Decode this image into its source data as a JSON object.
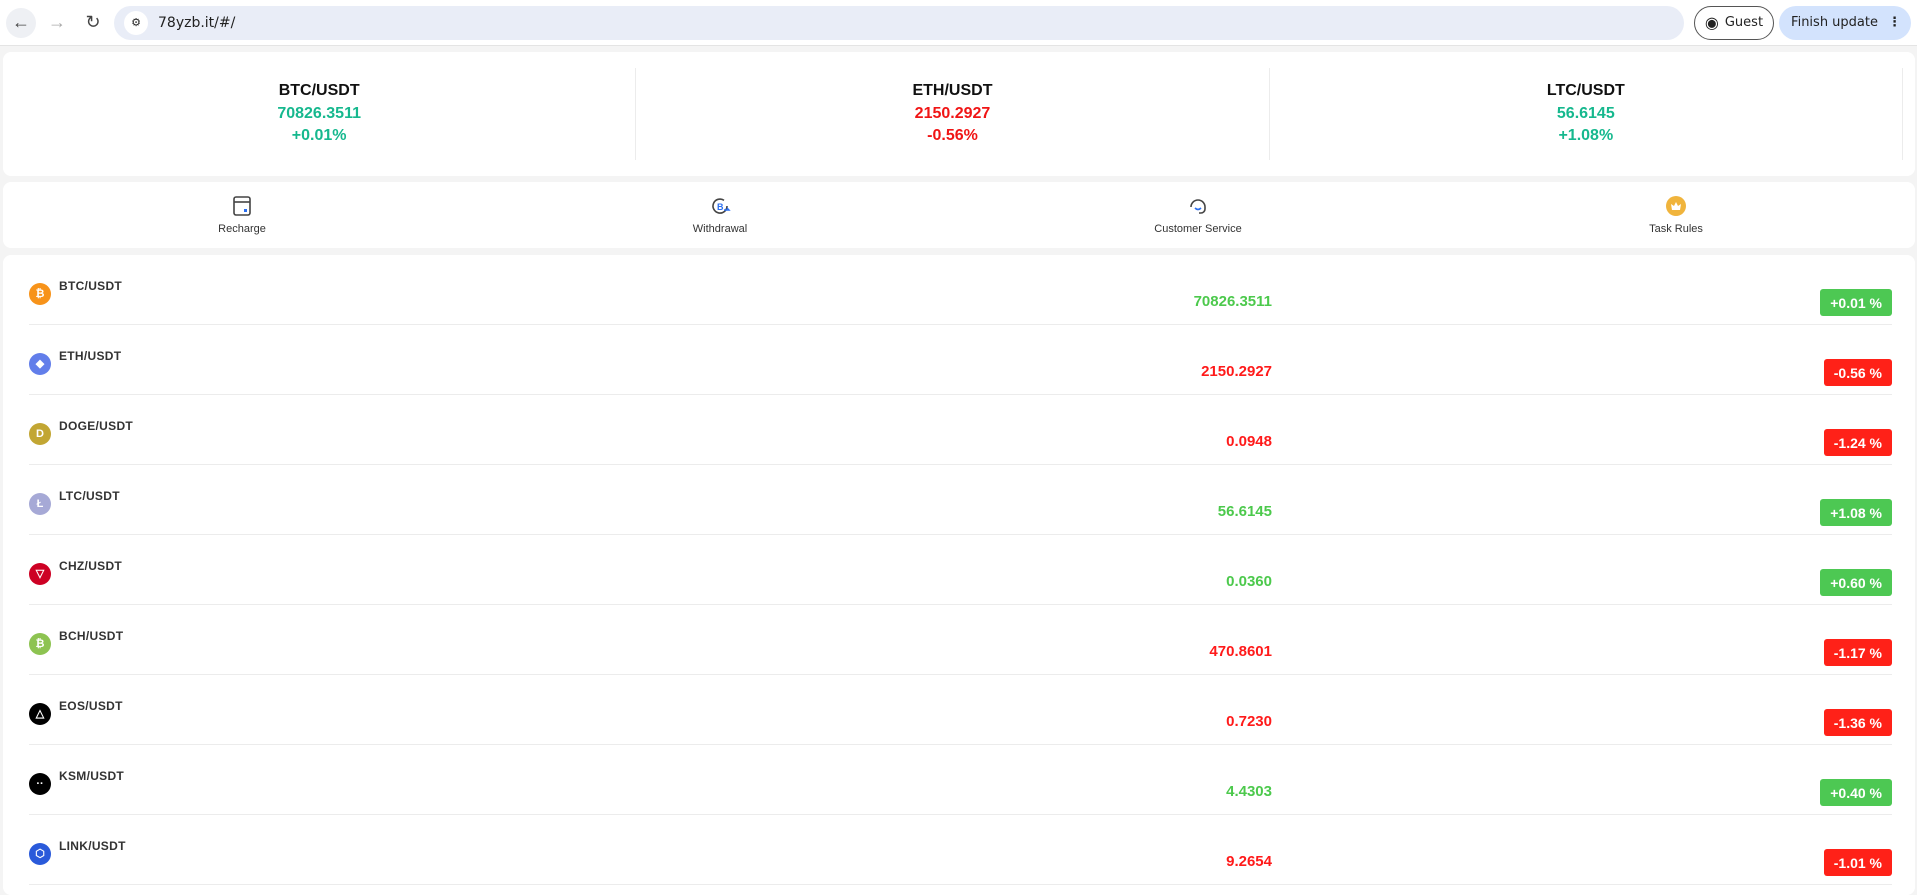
{
  "browser": {
    "url": "78yzb.it/#/",
    "profile_label": "Guest",
    "update_label": "Finish update"
  },
  "tickers": [
    {
      "pair": "BTC/USDT",
      "price": "70826.3511",
      "change": "+0.01%",
      "trend": "up"
    },
    {
      "pair": "ETH/USDT",
      "price": "2150.2927",
      "change": "-0.56%",
      "trend": "down"
    },
    {
      "pair": "LTC/USDT",
      "price": "56.6145",
      "change": "+1.08%",
      "trend": "up"
    }
  ],
  "nav": [
    {
      "label": "Recharge",
      "icon": "wallet-icon"
    },
    {
      "label": "Withdrawal",
      "icon": "withdraw-icon"
    },
    {
      "label": "Customer Service",
      "icon": "headset-icon"
    },
    {
      "label": "Task Rules",
      "icon": "crown-icon"
    }
  ],
  "markets": [
    {
      "pair": "BTC/USDT",
      "price": "70826.3511",
      "change": "+0.01 %",
      "trend": "up",
      "color": "#f7931a",
      "glyph": "₿"
    },
    {
      "pair": "ETH/USDT",
      "price": "2150.2927",
      "change": "-0.56 %",
      "trend": "down",
      "color": "#627eea",
      "glyph": "◆"
    },
    {
      "pair": "DOGE/USDT",
      "price": "0.0948",
      "change": "-1.24 %",
      "trend": "down",
      "color": "#c2a633",
      "glyph": "D"
    },
    {
      "pair": "LTC/USDT",
      "price": "56.6145",
      "change": "+1.08 %",
      "trend": "up",
      "color": "#a6a9d6",
      "glyph": "Ł"
    },
    {
      "pair": "CHZ/USDT",
      "price": "0.0360",
      "change": "+0.60 %",
      "trend": "up",
      "color": "#cd0124",
      "glyph": "▽"
    },
    {
      "pair": "BCH/USDT",
      "price": "470.8601",
      "change": "-1.17 %",
      "trend": "down",
      "color": "#8dc351",
      "glyph": "₿"
    },
    {
      "pair": "EOS/USDT",
      "price": "0.7230",
      "change": "-1.36 %",
      "trend": "down",
      "color": "#000000",
      "glyph": "△"
    },
    {
      "pair": "KSM/USDT",
      "price": "4.4303",
      "change": "+0.40 %",
      "trend": "up",
      "color": "#000000",
      "glyph": "··"
    },
    {
      "pair": "LINK/USDT",
      "price": "9.2654",
      "change": "-1.01 %",
      "trend": "down",
      "color": "#2a5ada",
      "glyph": "⬡"
    }
  ]
}
